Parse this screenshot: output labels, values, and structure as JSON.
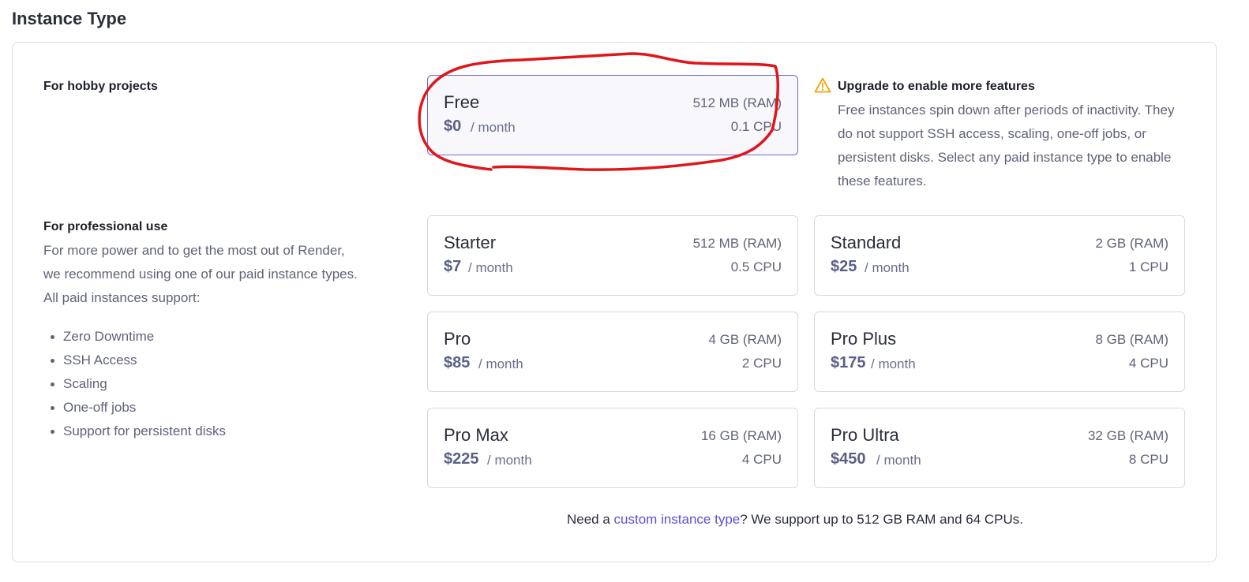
{
  "page": {
    "title": "Instance Type"
  },
  "hobby": {
    "heading": "For hobby projects"
  },
  "professional": {
    "heading": "For professional use",
    "description": "For more power and to get the most out of Render, we recommend using one of our paid instance types. All paid instances support:",
    "features": [
      "Zero Downtime",
      "SSH Access",
      "Scaling",
      "One-off jobs",
      "Support for persistent disks"
    ]
  },
  "upgrade": {
    "icon": "warning-icon",
    "title": "Upgrade to enable more features",
    "description": "Free instances spin down after periods of inactivity. They do not support SSH access, scaling, one-off jobs, or persistent disks. Select any paid instance type to enable these features."
  },
  "per_month": "/ month",
  "instances": [
    {
      "name": "Free",
      "price": "$0",
      "ram": "512 MB (RAM)",
      "cpu": "0.1 CPU",
      "selected": true
    },
    {
      "name": "Starter",
      "price": "$7",
      "ram": "512 MB (RAM)",
      "cpu": "0.5 CPU"
    },
    {
      "name": "Standard",
      "price": "$25",
      "ram": "2 GB (RAM)",
      "cpu": "1 CPU"
    },
    {
      "name": "Pro",
      "price": "$85",
      "ram": "4 GB (RAM)",
      "cpu": "2 CPU"
    },
    {
      "name": "Pro Plus",
      "price": "$175",
      "ram": "8 GB (RAM)",
      "cpu": "4 CPU"
    },
    {
      "name": "Pro Max",
      "price": "$225",
      "ram": "16 GB (RAM)",
      "cpu": "4 CPU"
    },
    {
      "name": "Pro Ultra",
      "price": "$450",
      "ram": "32 GB (RAM)",
      "cpu": "8 CPU"
    }
  ],
  "custom": {
    "prefix": "Need a ",
    "link": "custom instance type",
    "suffix": "? We support up to 512 GB RAM and 64 CPUs."
  },
  "colors": {
    "accent": "#5b4fd6",
    "selected_border": "#6e6ad6",
    "annotation": "#e0161b",
    "warning": "#f0a500"
  }
}
